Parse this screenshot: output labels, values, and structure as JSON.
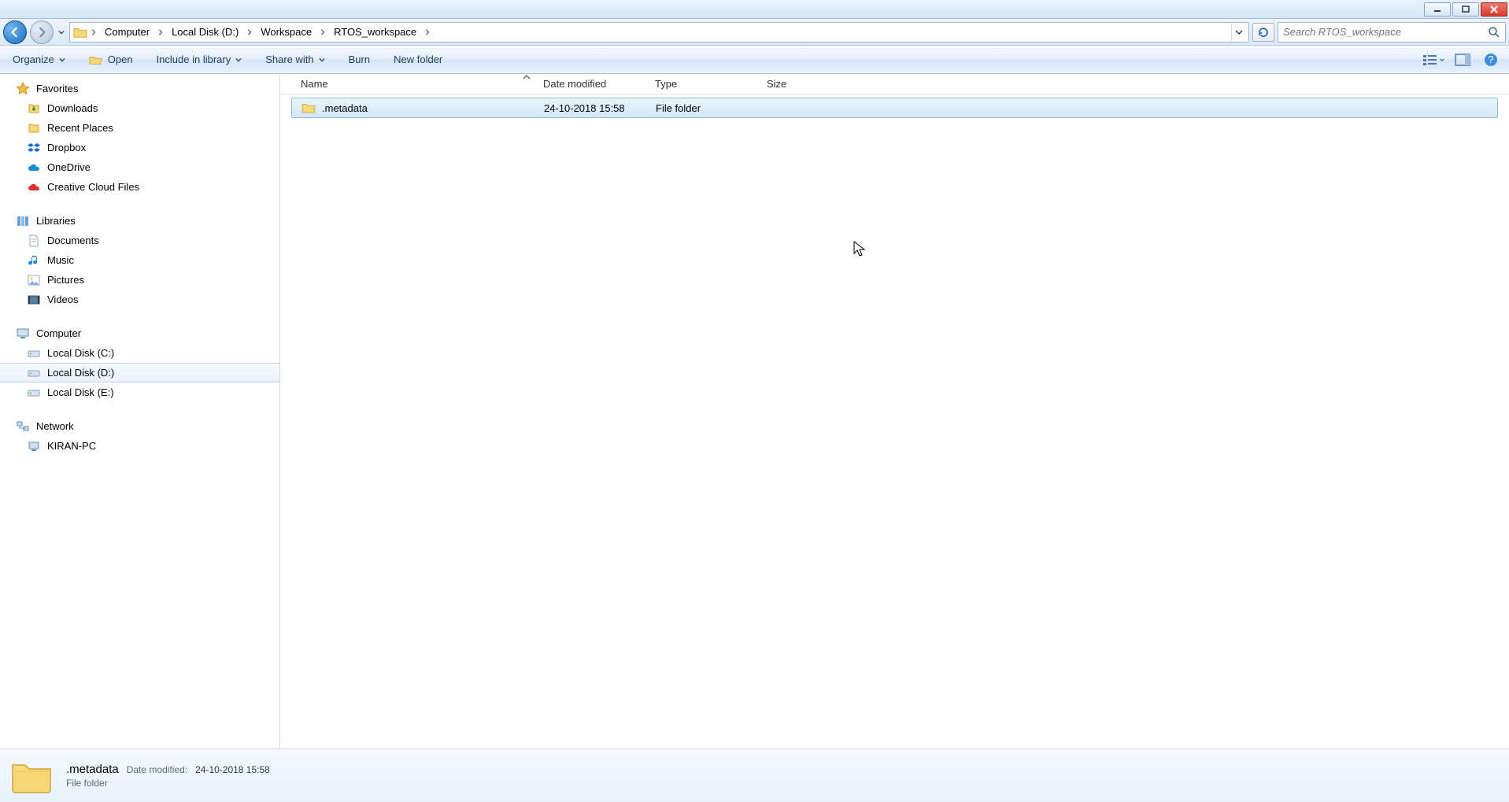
{
  "window_buttons": {
    "min": "minimize",
    "max": "maximize",
    "close": "close"
  },
  "breadcrumb": {
    "items": [
      "Computer",
      "Local Disk (D:)",
      "Workspace",
      "RTOS_workspace"
    ]
  },
  "search": {
    "placeholder": "Search RTOS_workspace"
  },
  "toolbar": {
    "organize": "Organize",
    "open": "Open",
    "include": "Include in library",
    "share": "Share with",
    "burn": "Burn",
    "newfolder": "New folder"
  },
  "sidebar": {
    "favorites": {
      "label": "Favorites",
      "items": [
        "Downloads",
        "Recent Places",
        "Dropbox",
        "OneDrive",
        "Creative Cloud Files"
      ]
    },
    "libraries": {
      "label": "Libraries",
      "items": [
        "Documents",
        "Music",
        "Pictures",
        "Videos"
      ]
    },
    "computer": {
      "label": "Computer",
      "items": [
        "Local Disk (C:)",
        "Local Disk (D:)",
        "Local Disk (E:)"
      ],
      "active_index": 1
    },
    "network": {
      "label": "Network",
      "items": [
        "KIRAN-PC"
      ]
    }
  },
  "columns": {
    "name": "Name",
    "date": "Date modified",
    "type": "Type",
    "size": "Size"
  },
  "files": [
    {
      "name": ".metadata",
      "date": "24-10-2018 15:58",
      "type": "File folder",
      "size": ""
    }
  ],
  "details": {
    "name": ".metadata",
    "date_label": "Date modified:",
    "date_value": "24-10-2018 15:58",
    "type": "File folder"
  }
}
